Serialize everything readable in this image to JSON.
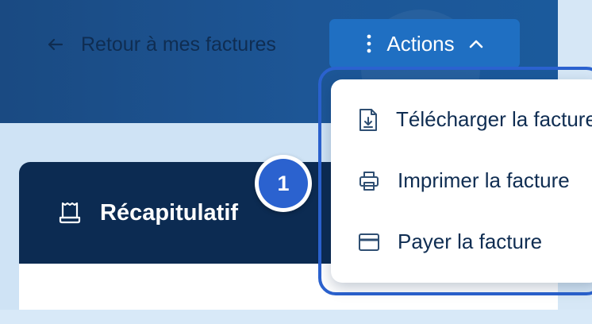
{
  "header": {
    "back_label": "Retour à mes factures",
    "actions_label": "Actions"
  },
  "menu": {
    "items": [
      {
        "label": "Télécharger la facture",
        "icon": "download-file-icon"
      },
      {
        "label": "Imprimer la facture",
        "icon": "printer-icon"
      },
      {
        "label": "Payer la facture",
        "icon": "card-icon"
      }
    ]
  },
  "card": {
    "title": "Récapitulatif"
  },
  "badge": {
    "number": "1"
  },
  "colors": {
    "header_bg": "#1d5696",
    "actions_bg": "#1f6fc2",
    "card_header_bg": "#0c2b52",
    "highlight": "#2b62cf",
    "text_dark": "#0f2d52"
  }
}
